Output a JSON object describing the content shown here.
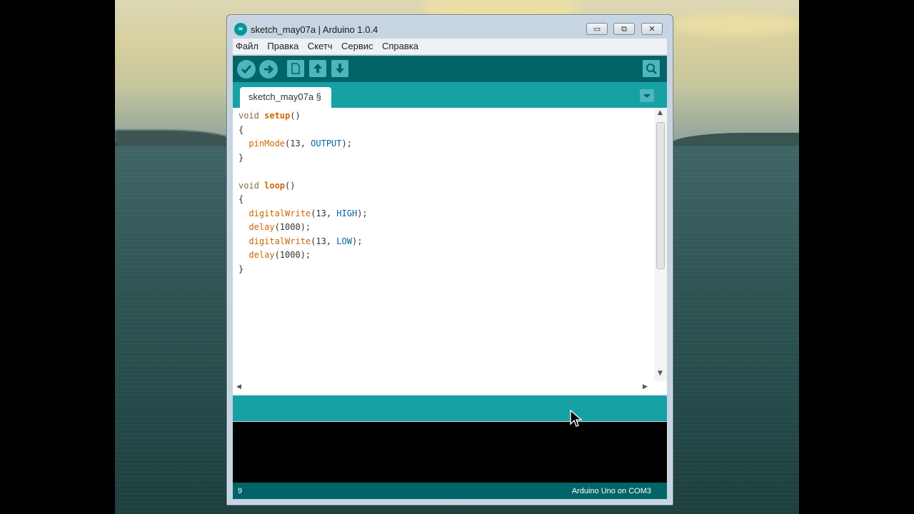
{
  "window": {
    "title": "sketch_may07a | Arduino 1.0.4",
    "app_icon": "arduino-infinity-icon",
    "buttons": {
      "minimize": "▭",
      "maximize": "⧉",
      "close": "✕"
    }
  },
  "menu": [
    "Файл",
    "Правка",
    "Скетч",
    "Сервис",
    "Справка"
  ],
  "toolbar": {
    "icons": [
      "verify-icon",
      "upload-icon",
      "new-icon",
      "open-icon",
      "save-icon",
      "serial-monitor-icon"
    ]
  },
  "tab": {
    "label": "sketch_may07a §"
  },
  "code": {
    "lines": [
      [
        {
          "t": "void ",
          "c": "kw"
        },
        {
          "t": "setup",
          "c": "kw-bold"
        },
        {
          "t": "()",
          "c": ""
        }
      ],
      [
        {
          "t": "{",
          "c": ""
        }
      ],
      [
        {
          "t": "  ",
          "c": ""
        },
        {
          "t": "pinMode",
          "c": "fn"
        },
        {
          "t": "(13, ",
          "c": ""
        },
        {
          "t": "OUTPUT",
          "c": "const"
        },
        {
          "t": ");",
          "c": ""
        }
      ],
      [
        {
          "t": "}",
          "c": ""
        }
      ],
      [
        {
          "t": "",
          "c": ""
        }
      ],
      [
        {
          "t": "void ",
          "c": "kw"
        },
        {
          "t": "loop",
          "c": "kw-bold"
        },
        {
          "t": "()",
          "c": ""
        }
      ],
      [
        {
          "t": "{",
          "c": ""
        }
      ],
      [
        {
          "t": "  ",
          "c": ""
        },
        {
          "t": "digitalWrite",
          "c": "fn"
        },
        {
          "t": "(13, ",
          "c": ""
        },
        {
          "t": "HIGH",
          "c": "const"
        },
        {
          "t": ");",
          "c": ""
        }
      ],
      [
        {
          "t": "  ",
          "c": ""
        },
        {
          "t": "delay",
          "c": "fn"
        },
        {
          "t": "(1000);",
          "c": ""
        }
      ],
      [
        {
          "t": "  ",
          "c": ""
        },
        {
          "t": "digitalWrite",
          "c": "fn"
        },
        {
          "t": "(13, ",
          "c": ""
        },
        {
          "t": "LOW",
          "c": "const"
        },
        {
          "t": ");",
          "c": ""
        }
      ],
      [
        {
          "t": "  ",
          "c": ""
        },
        {
          "t": "delay",
          "c": "fn"
        },
        {
          "t": "(1000);",
          "c": ""
        }
      ],
      [
        {
          "t": "}",
          "c": ""
        }
      ]
    ]
  },
  "status": {
    "line": "9",
    "board": "Arduino Uno on COM3"
  },
  "colors": {
    "toolbar": "#006468",
    "tabbar": "#17a1a5",
    "button": "#4db7bb",
    "console": "#000000"
  }
}
